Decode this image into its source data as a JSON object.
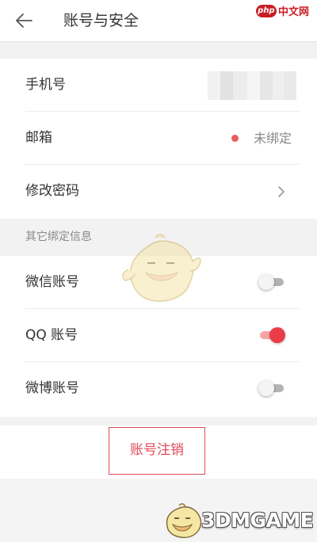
{
  "header": {
    "title": "账号与安全",
    "back_icon": "arrow-left-icon"
  },
  "watermark_top": {
    "badge": "php",
    "text": "中文网"
  },
  "account": {
    "phone": {
      "label": "手机号",
      "value_state": "blurred"
    },
    "email": {
      "label": "邮箱",
      "status": "未绑定",
      "status_color": "#e85d5f"
    },
    "password": {
      "label": "修改密码",
      "icon": "chevron-right-icon"
    }
  },
  "other_bindings": {
    "section_title": "其它绑定信息",
    "items": [
      {
        "label": "微信账号",
        "enabled": false
      },
      {
        "label": "QQ 账号",
        "enabled": true
      },
      {
        "label": "微博账号",
        "enabled": false
      }
    ]
  },
  "cancel": {
    "label": "账号注销",
    "color": "#e04a57"
  },
  "watermark_bottom": {
    "brand": "3DMGAME"
  },
  "colors": {
    "accent": "#ea3d48",
    "background": "#f2f2f2",
    "card": "#ffffff"
  }
}
